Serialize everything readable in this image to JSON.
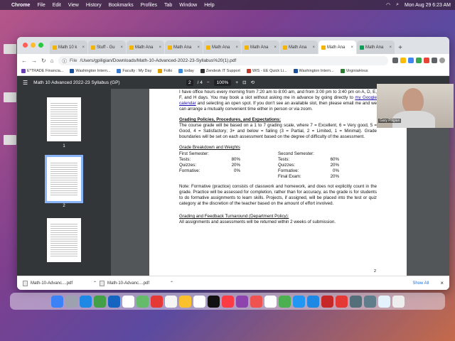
{
  "menubar": {
    "app": "Chrome",
    "items": [
      "File",
      "Edit",
      "View",
      "History",
      "Bookmarks",
      "Profiles",
      "Tab",
      "Window",
      "Help"
    ],
    "datetime": "Mon Aug 29  6:23 AM"
  },
  "tabs": [
    {
      "label": "Math 10 k",
      "color": "#f4b400"
    },
    {
      "label": "Stuff - Gu",
      "color": "#f4b400"
    },
    {
      "label": "Math Ana",
      "color": "#f4b400"
    },
    {
      "label": "Math Ana",
      "color": "#f4b400"
    },
    {
      "label": "Math Ana",
      "color": "#f4b400"
    },
    {
      "label": "Math Ana",
      "color": "#f4b400"
    },
    {
      "label": "Math Ana",
      "color": "#f4b400"
    },
    {
      "label": "Math Ana",
      "color": "#f4b400"
    },
    {
      "label": "Math Ana",
      "color": "#0f9d58"
    }
  ],
  "address": {
    "scheme": "File",
    "url": "/Users/gpiligian/Downloads/Math-10-Advanced-2022-23-Syllabus%20(1).pdf"
  },
  "bookmarks": [
    {
      "label": "E*TRADE Financia...",
      "color": "#6a3fb3"
    },
    {
      "label": "Washington Intern...",
      "color": "#1a4f9c"
    },
    {
      "label": "Faculty : My Day",
      "color": "#3a7bd5"
    },
    {
      "label": "Follo",
      "color": "#e0a100"
    },
    {
      "label": "today",
      "color": "#3c8dde"
    },
    {
      "label": "Zendesk IT Support",
      "color": "#333333"
    },
    {
      "label": "WIS - EE Quick Li...",
      "color": "#c0392b"
    },
    {
      "label": "Washington Intern...",
      "color": "#1a4f9c"
    },
    {
      "label": "VirginiaHous",
      "color": "#2e7d32"
    }
  ],
  "pdf": {
    "title": "Math 10 Advanced 2022-23 Syllabus (GP)",
    "page_current": "2",
    "page_total": "/  4",
    "zoom": "100%",
    "thumb_labels": [
      "1",
      "2"
    ],
    "page_number": "2"
  },
  "doc": {
    "office": "I have office hours every morning from 7:20 am to 8:00 am, and from 3:00 pm to 3:40 pm on A, D, E, F, and H days.  You may book a slot without asking me in advance by going directly to",
    "office_link": "my Google calendar",
    "office_rest": "and selecting an open spot.  If you don't see an available slot, then please email me and we can arrange a mutually convenient time either in person or via zoom.",
    "policies_heading": "Grading Policies, Procedures, and Expectations:",
    "policies": "The course grade will be based on a 1 to 7 grading scale, where 7 = Excellent, 6 = Very good, 5 = Good, 4 = Satisfactory; 3+ and below = failing (3 = Partial, 2 = Limited, 1 = Minimal).  Grade boundaries will be set on each assessment based on the degree of difficulty of the assessment.",
    "breakdown_heading": "Grade Breakdown and Weights",
    "first_semester": {
      "title": "First Semester:",
      "rows": [
        {
          "label": "Tests:",
          "value": "80%"
        },
        {
          "label": "Quizzes:",
          "value": "20%"
        },
        {
          "label": "Formative:",
          "value": "0%"
        }
      ]
    },
    "second_semester": {
      "title": "Second Semester:",
      "rows": [
        {
          "label": "Tests:",
          "value": "60%"
        },
        {
          "label": "Quizzes:",
          "value": "20%"
        },
        {
          "label": "Formative:",
          "value": "0%"
        },
        {
          "label": "Final Exam:",
          "value": "20%"
        }
      ]
    },
    "note": "Note:  Formative (practice) consists of classwork and homework, and does not explicitly count in the grade.  Practice will be assessed for completion, rather than for accuracy, as the grade is for students to do formative assignments to learn skills.  Projects, if assigned, will be placed into the test or quiz category at the discretion of the teacher based on the amount of effort involved.",
    "feedback_heading": "Grading and Feedback Turnaround (Department Policy):",
    "feedback": "All assignments and assessments will be returned within 2 weeks of submission."
  },
  "downloads": {
    "items": [
      "Math-10-Advanc....pdf",
      "Math-10-Advanc....pdf"
    ],
    "show_all": "Show All"
  },
  "webcam": {
    "name": "Gary Piligian"
  },
  "dock": {
    "colors": [
      "#3b82f6",
      "#9ca3af",
      "#1e88e5",
      "#43a047",
      "#1565c0",
      "#ffffff",
      "#66bb6a",
      "#e53935",
      "#f5f5f5",
      "#fbc02d",
      "#ffffff",
      "#111111",
      "#fc3c44",
      "#8e44ad",
      "#ef5350",
      "#ffffff",
      "#4caf50",
      "#2196f3",
      "#1e88e5",
      "#c62828",
      "#e53935",
      "#546e7a",
      "#607d8b",
      "#e3f2fd",
      "#eeeeee"
    ]
  }
}
